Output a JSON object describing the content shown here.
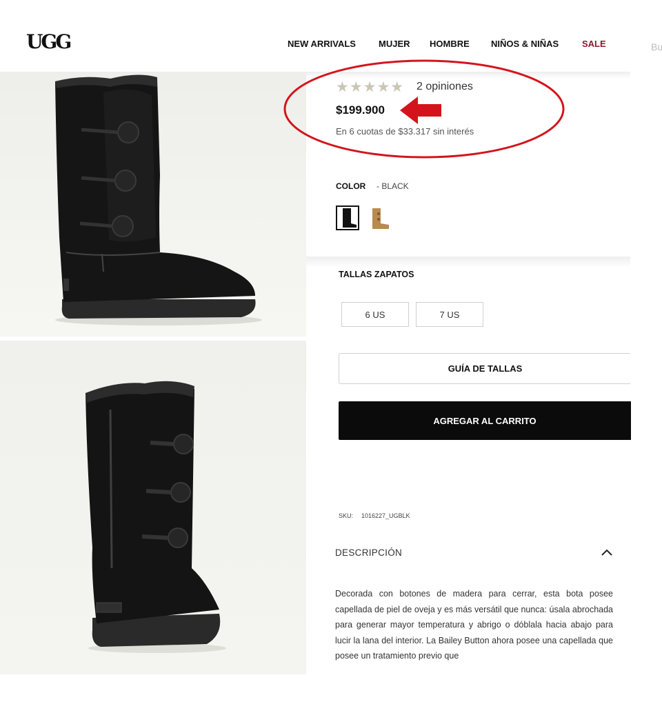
{
  "header": {
    "logo": "UGG",
    "nav": [
      {
        "label": "NEW ARRIVALS"
      },
      {
        "label": "MUJER"
      },
      {
        "label": "HOMBRE"
      },
      {
        "label": "NIÑOS & NIÑAS"
      },
      {
        "label": "SALE"
      }
    ],
    "overflow_text": "Bu"
  },
  "product": {
    "rating": {
      "stars": 5,
      "stars_glyphs": "★★★★★",
      "reviews_text": "2 opiniones"
    },
    "price": "$199.900",
    "installments": "En 6 cuotas de $33.317 sin interés",
    "color": {
      "label": "COLOR",
      "value": "- BLACK",
      "swatches": [
        {
          "name": "black",
          "selected": true
        },
        {
          "name": "chestnut",
          "selected": false
        }
      ]
    },
    "sizes": {
      "title": "TALLAS ZAPATOS",
      "options": [
        "6 US",
        "7 US"
      ]
    },
    "size_guide_label": "GUÍA DE TALLAS",
    "add_to_cart_label": "AGREGAR AL CARRITO",
    "sku_label": "SKU:",
    "sku_value": "1016227_UGBLK",
    "description": {
      "title": "DESCRIPCIÓN",
      "text": "Decorada con botones de madera para cerrar, esta bota posee capellada de piel de oveja y es más versátil que nunca: úsala abrochada para generar mayor temperatura y abrigo o dóblala hacia abajo para lucir la lana del interior. La Bailey Button ahora posee una capellada que posee un tratamiento previo que"
    }
  },
  "annotation": {
    "color": "#d4141c"
  },
  "colors": {
    "sale": "#8b1a2b",
    "cart_button": "#0b0b0b",
    "star": "#c9c6b4"
  }
}
